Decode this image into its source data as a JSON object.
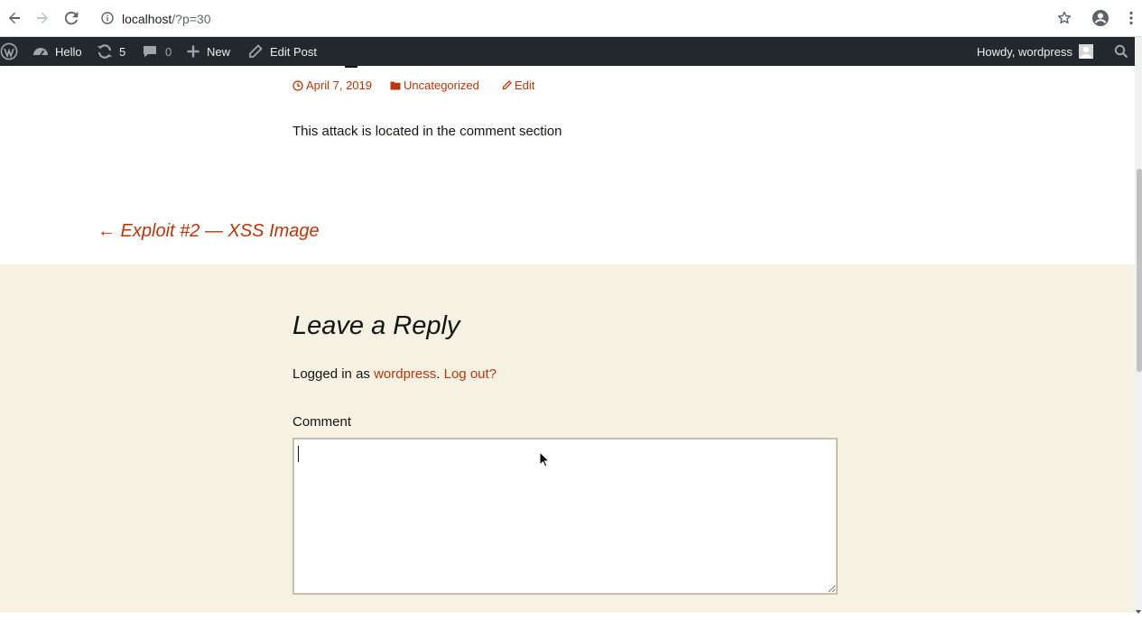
{
  "browser": {
    "url_host": "localhost",
    "url_path": "/?p=30"
  },
  "admin_bar": {
    "site_name": "Hello",
    "updates_count": "5",
    "comments_count": "0",
    "new_label": "New",
    "edit_label": "Edit Post",
    "howdy_label": "Howdy, wordpress"
  },
  "post": {
    "date": "April 7, 2019",
    "category": "Uncategorized",
    "edit_label": "Edit",
    "content": "This attack is located in the comment section"
  },
  "navigation": {
    "previous": "← Exploit #2 — XSS Image"
  },
  "reply": {
    "title": "Leave a Reply",
    "logged_in_prefix": "Logged in as ",
    "username": "wordpress",
    "period": ". ",
    "logout_label": "Log out?",
    "comment_label": "Comment",
    "comment_value": ""
  },
  "colors": {
    "accent": "#bc360a",
    "admin_bar": "#23282d",
    "reply_bg": "#f5f1e3"
  }
}
